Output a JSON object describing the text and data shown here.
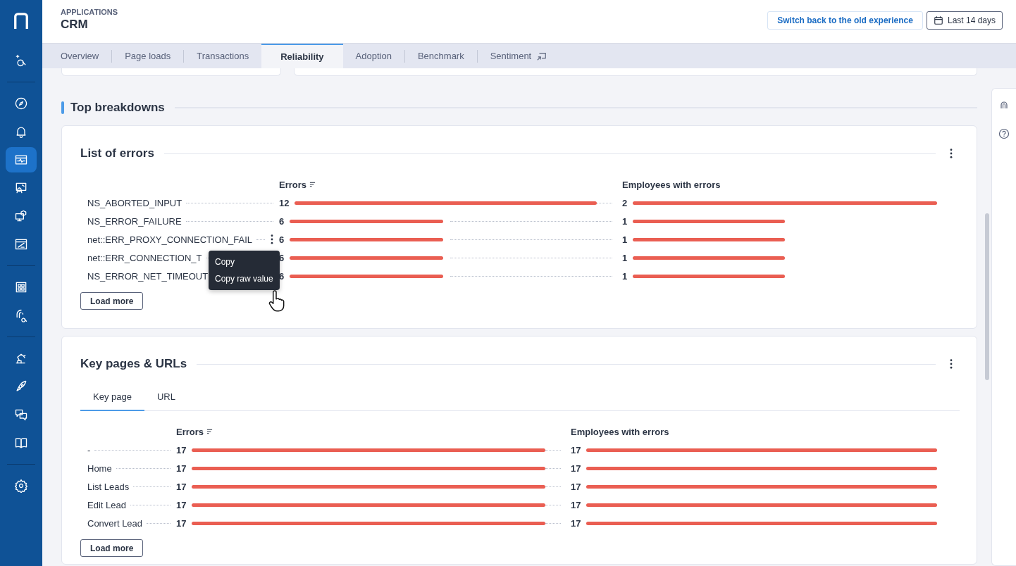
{
  "header": {
    "eyebrow": "APPLICATIONS",
    "title": "CRM",
    "switch_button": "Switch back to the old experience",
    "date_button": "Last 14 days"
  },
  "nav_groups": [
    [
      {
        "selected": false
      }
    ],
    [
      {
        "selected": false
      },
      {
        "selected": false
      },
      {
        "selected": true
      },
      {
        "selected": false
      },
      {
        "selected": false
      },
      {
        "selected": false
      }
    ],
    [
      {
        "selected": false
      },
      {
        "selected": false
      }
    ],
    [
      {
        "selected": false
      },
      {
        "selected": false
      },
      {
        "selected": false
      },
      {
        "selected": false
      }
    ],
    [
      {
        "selected": false
      }
    ]
  ],
  "tabs": [
    {
      "label": "Overview",
      "selected": false,
      "kind": "plain"
    },
    {
      "label": "Page loads",
      "selected": false,
      "kind": "plain"
    },
    {
      "label": "Transactions",
      "selected": false,
      "kind": "plain"
    },
    {
      "label": "Reliability",
      "selected": true,
      "kind": "plain"
    },
    {
      "label": "Adoption",
      "selected": false,
      "kind": "plain"
    },
    {
      "label": "Benchmark",
      "selected": false,
      "kind": "plain"
    },
    {
      "label": "Sentiment",
      "selected": false,
      "kind": "external"
    }
  ],
  "section_title": "Top breakdowns",
  "errors_card": {
    "title": "List of errors",
    "columns": [
      "Errors",
      "Employees with errors"
    ],
    "rows": [
      {
        "name": "NS_ABORTED_INPUT",
        "errors": {
          "value": "12",
          "level": 1
        },
        "employees": {
          "value": "2",
          "level": 1
        }
      },
      {
        "name": "NS_ERROR_FAILURE",
        "errors": {
          "value": "6",
          "level": 0.5
        },
        "employees": {
          "value": "1",
          "level": 0.5
        }
      },
      {
        "name": "net::ERR_PROXY_CONNECTION_FAIL",
        "errors": {
          "value": "6",
          "level": 0.5
        },
        "employees": {
          "value": "1",
          "level": 0.5
        },
        "context_menu": [
          "Copy",
          "Copy raw value"
        ]
      },
      {
        "name": "net::ERR_CONNECTION_T",
        "errors": {
          "value": "6",
          "level": 0.5
        },
        "employees": {
          "value": "1",
          "level": 0.5
        }
      },
      {
        "name": "NS_ERROR_NET_TIMEOUT",
        "errors": {
          "value": "6",
          "level": 0.5
        },
        "employees": {
          "value": "1",
          "level": 0.5
        }
      }
    ],
    "load_more": "Load more"
  },
  "pages_card": {
    "title": "Key pages & URLs",
    "tabs": [
      {
        "label": "Key page",
        "selected": true
      },
      {
        "label": "URL",
        "selected": false
      }
    ],
    "columns": [
      "Errors",
      "Employees with errors"
    ],
    "rows": [
      {
        "name": "-",
        "errors": {
          "value": "17",
          "level": 1
        },
        "employees": {
          "value": "17",
          "level": 1
        }
      },
      {
        "name": "Home",
        "errors": {
          "value": "17",
          "level": 1
        },
        "employees": {
          "value": "17",
          "level": 1
        }
      },
      {
        "name": "List Leads",
        "errors": {
          "value": "17",
          "level": 1
        },
        "employees": {
          "value": "17",
          "level": 1
        }
      },
      {
        "name": "Edit Lead",
        "errors": {
          "value": "17",
          "level": 1
        },
        "employees": {
          "value": "17",
          "level": 1
        }
      },
      {
        "name": "Convert Lead",
        "errors": {
          "value": "17",
          "level": 1
        },
        "employees": {
          "value": "17",
          "level": 1
        }
      }
    ],
    "load_more": "Load more"
  }
}
